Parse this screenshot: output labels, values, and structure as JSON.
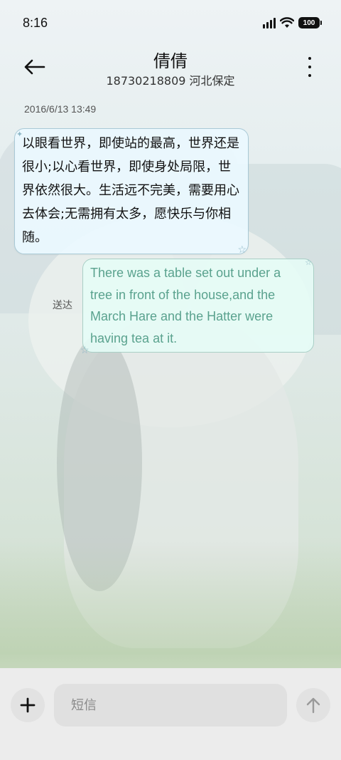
{
  "status_bar": {
    "time": "8:16",
    "battery": "100",
    "icons": [
      "signal-icon",
      "wifi-icon",
      "battery-icon"
    ]
  },
  "header": {
    "contact_name": "倩倩",
    "contact_info": "18730218809 河北保定",
    "back_icon": "back-arrow-icon",
    "more_icon": "more-vertical-icon"
  },
  "conversation": {
    "timestamp": "2016/6/13 13:49",
    "messages": [
      {
        "direction": "incoming",
        "text": "以眼看世界，即使站的最高，世界还是很小;以心看世界，即使身处局限，世界依然很大。生活远不完美，需要用心去体会;无需拥有太多，愿快乐与你相随。"
      },
      {
        "direction": "outgoing",
        "text": "There was a table set out under a tree in front of the house,and the March Hare and the Hatter were having tea at it.",
        "status": "送达"
      }
    ]
  },
  "composer": {
    "placeholder": "短信",
    "value": "",
    "add_icon": "plus-icon",
    "send_icon": "arrow-up-icon"
  },
  "colors": {
    "incoming_border": "#a9c9d6",
    "outgoing_text": "#5aa28e",
    "input_bar_bg": "#ececec"
  }
}
